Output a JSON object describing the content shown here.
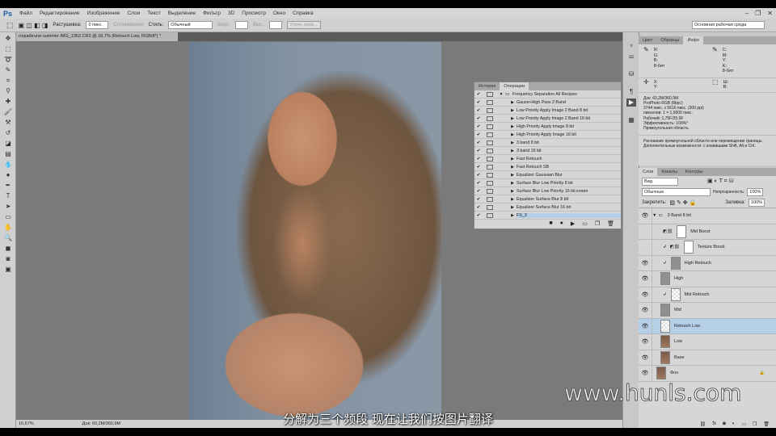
{
  "menu": {
    "logo": "Ps",
    "items": [
      "Файл",
      "Редактирование",
      "Изображение",
      "Слои",
      "Текст",
      "Выделение",
      "Фильтр",
      "3D",
      "Просмотр",
      "Окно",
      "Справка"
    ]
  },
  "window_controls": [
    "–",
    "❐",
    "✕"
  ],
  "options": {
    "feather_label": "Растушевка:",
    "feather_value": "0 пикс.",
    "antialias": "Сглаживание",
    "style_label": "Стиль:",
    "style_value": "Обычный",
    "width_label": "Шир.:",
    "height_label": "Выс.:",
    "refine": "Уточн. край...",
    "workspace": "Основная рабочая среда"
  },
  "document": {
    "tab": "roquebrune-summer IMG_1952.CR2 @ 16,7% (Retouch Low, RGB/8*) *",
    "zoom": "16,67%",
    "doc_size": "Док: 60,2M/360,9M"
  },
  "actions_panel": {
    "tabs": [
      "История",
      "Операции"
    ],
    "items": [
      "Frequency Separation All Recipes",
      "Gauss+High Pass 2 Band",
      "Low Priority Apply Image 2 Band 8 bit",
      "Low Priority Apply Image 2 Band 16 bit",
      "High Priority Apply Image 8 bit",
      "High Priority Apply Image 16 bit",
      "3 band 8 bit",
      "3 band 16 bit",
      "Fast Retouch",
      "Fast Retouch SB",
      "Equalizer Gaussian Blur",
      "Surface Blur Low Priority 8 bit",
      "Surface Blur Low Priority 16 bit копия",
      "Equalizer Surface Blur 8 bit",
      "Equalizer Surface Blur 16 bit",
      "FS_3"
    ]
  },
  "info_panel": {
    "tabs": [
      "Цвет",
      "Образцы",
      "Инфо"
    ],
    "rgb": "R:\nG:\nB:",
    "cmyk": "C:\nM:\nY:\nK:",
    "bit1": "8-бит",
    "bit2": "8-бит",
    "xy": "X:\nY:",
    "wh": "Ш:\nВ:",
    "details": [
      "Док: 60,2M/360,9M",
      "ProPhoto RGB (8bpc)",
      "3744 пикс. x 5616 пикс. (300 ppi)",
      "пикселов: 1 = 1,0000 пикс.",
      "Рабочий: 1,75F/25,9F",
      "Эффективность: 100%*",
      "Прямоугольная область"
    ],
    "hint": "Рисование прямоугольной области или перемещение границы. Дополнительные возможности: с клавишами Shift, Alt и Ctrl."
  },
  "layers_panel": {
    "tabs": [
      "Слои",
      "Каналы",
      "Контуры"
    ],
    "filter": "Вид",
    "blend": "Обычные",
    "opacity_label": "Непрозрачность:",
    "opacity": "100%",
    "lock_label": "Закрепить:",
    "fill_label": "Заливка:",
    "fill": "100%",
    "layers": [
      "3 Band 8 bit",
      "Mid Boost",
      "Texture Boost",
      "High Retouch",
      "High",
      "Mid Retouch",
      "Mid",
      "Retouch Low",
      "Low",
      "Base",
      "Фон"
    ]
  },
  "subtitle": "分解为三个频段 现在让我们按图片翻译",
  "watermark": "www.hunls.com"
}
